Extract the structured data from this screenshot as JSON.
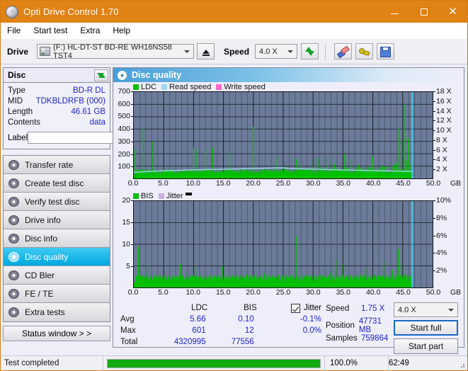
{
  "window": {
    "title": "Opti Drive Control 1.70",
    "icon": "disc-icon",
    "minimize": "–",
    "maximize": "□",
    "close": "✕"
  },
  "menu": {
    "items": [
      "File",
      "Start test",
      "Extra",
      "Help"
    ]
  },
  "toolbar": {
    "drive_label": "Drive",
    "drive_value": "(F:)  HL-DT-ST BD-RE  WH16NS58 TST4",
    "eject": "eject-icon",
    "speed_label": "Speed",
    "speed_value": "4.0 X",
    "icons": [
      "refresh-icon",
      "eraser-icon",
      "wrench-icon",
      "save-icon"
    ]
  },
  "disc": {
    "title": "Disc",
    "refresh_icon": "refresh-icon",
    "rows": [
      {
        "key": "Type",
        "value": "BD-R DL"
      },
      {
        "key": "MID",
        "value": "TDKBLDRFB (000)"
      },
      {
        "key": "Length",
        "value": "46.61 GB"
      },
      {
        "key": "Contents",
        "value": "data"
      }
    ],
    "label_key": "Label",
    "label_value": "",
    "label_placeholder": ""
  },
  "sidebar": {
    "items": [
      {
        "label": "Transfer rate",
        "selected": false
      },
      {
        "label": "Create test disc",
        "selected": false
      },
      {
        "label": "Verify test disc",
        "selected": false
      },
      {
        "label": "Drive info",
        "selected": false
      },
      {
        "label": "Disc info",
        "selected": false
      },
      {
        "label": "Disc quality",
        "selected": true
      },
      {
        "label": "CD Bler",
        "selected": false
      },
      {
        "label": "FE / TE",
        "selected": false
      },
      {
        "label": "Extra tests",
        "selected": false
      }
    ],
    "status_window": "Status window > >"
  },
  "panel": {
    "title": "Disc quality",
    "icon": "disc-quality-icon"
  },
  "stats": {
    "col_headers": [
      "",
      "LDC",
      "BIS",
      "Jitter"
    ],
    "jitter_checked": true,
    "rows": [
      {
        "label": "Avg",
        "ldc": "5.66",
        "bis": "0.10",
        "jitter": "-0.1%"
      },
      {
        "label": "Max",
        "ldc": "601",
        "bis": "12",
        "jitter": "0.0%"
      },
      {
        "label": "Total",
        "ldc": "4320995",
        "bis": "77556",
        "jitter": ""
      }
    ],
    "readout": [
      {
        "key": "Speed",
        "value": "1.75 X"
      },
      {
        "key": "Position",
        "value": "47731 MB"
      },
      {
        "key": "Samples",
        "value": "759864"
      }
    ],
    "speed_select": "4.0 X",
    "start_full": "Start full",
    "start_part": "Start part"
  },
  "statusbar": {
    "message": "Test completed",
    "percent_label": "100.0%",
    "percent_value": 100,
    "elapsed": "62:49"
  },
  "chart_data": [
    {
      "type": "area",
      "name": "ldc-chart",
      "title": "Disc quality - LDC",
      "xlabel": "GB",
      "ylabel": "LDC",
      "xlim": [
        0,
        50
      ],
      "ylim": [
        0,
        700
      ],
      "xticks": [
        "0.0",
        "5.0",
        "10.0",
        "15.0",
        "20.0",
        "25.0",
        "30.0",
        "35.0",
        "40.0",
        "45.0",
        "50.0"
      ],
      "yticks_left": [
        100,
        200,
        300,
        400,
        500,
        600,
        700
      ],
      "yticks_right": [
        "2 X",
        "4 X",
        "6 X",
        "8 X",
        "10 X",
        "12 X",
        "14 X",
        "16 X",
        "18 X"
      ],
      "y2lim": [
        0,
        19
      ],
      "unit": "GB",
      "grid": true,
      "legend": [
        {
          "label": "LDC",
          "color": "#00c000"
        },
        {
          "label": "Read speed",
          "color": "#9fd8f0"
        },
        {
          "label": "Write speed",
          "color": "#ff66cc"
        }
      ],
      "data_end_marker_gb": 46.6,
      "series": [
        {
          "name": "LDC",
          "color": "#00c000",
          "type": "spikes",
          "baseline": 28,
          "x": [
            0.2,
            0.5,
            0.9,
            1.3,
            1.6,
            2.0,
            2.4,
            2.8,
            3.2,
            3.6,
            4.0,
            4.4,
            4.8,
            5.2,
            5.6,
            6.0,
            6.4,
            6.8,
            7.2,
            7.6,
            8.0,
            8.4,
            8.8,
            9.2,
            9.6,
            10.0,
            10.4,
            10.8,
            11.2,
            11.6,
            12.0,
            12.4,
            12.8,
            13.2,
            13.6,
            14.0,
            14.4,
            14.8,
            15.2,
            15.6,
            16.0,
            16.4,
            16.8,
            17.2,
            17.6,
            18.0,
            18.4,
            18.8,
            19.2,
            19.6,
            20.0,
            20.4,
            20.8,
            21.2,
            21.6,
            22.0,
            22.4,
            22.8,
            23.2,
            23.6,
            24.0,
            24.4,
            24.8,
            25.2,
            25.6,
            26.0,
            26.4,
            26.8,
            27.2,
            27.6,
            28.0,
            28.4,
            28.8,
            29.2,
            29.6,
            30.0,
            30.4,
            30.8,
            31.2,
            31.6,
            32.0,
            32.4,
            32.8,
            33.2,
            33.6,
            34.0,
            34.4,
            34.8,
            35.2,
            35.6,
            36.0,
            36.4,
            36.8,
            37.2,
            37.6,
            38.0,
            38.4,
            38.8,
            39.2,
            39.6,
            40.0,
            40.4,
            40.8,
            41.2,
            41.6,
            42.0,
            42.4,
            42.8,
            43.2,
            43.6,
            44.0,
            44.4,
            44.8,
            45.2,
            45.6,
            46.0,
            46.4
          ],
          "y": [
            232,
            60,
            40,
            35,
            410,
            60,
            45,
            40,
            300,
            70,
            45,
            38,
            60,
            45,
            40,
            42,
            38,
            40,
            45,
            50,
            45,
            42,
            40,
            38,
            42,
            250,
            235,
            60,
            48,
            45,
            240,
            55,
            48,
            250,
            46,
            44,
            50,
            44,
            42,
            48,
            205,
            50,
            45,
            48,
            42,
            44,
            48,
            42,
            56,
            48,
            420,
            60,
            50,
            48,
            55,
            48,
            50,
            52,
            55,
            70,
            170,
            60,
            70,
            95,
            65,
            58,
            62,
            60,
            160,
            70,
            110,
            95,
            75,
            70,
            80,
            95,
            170,
            160,
            90,
            75,
            90,
            170,
            95,
            80,
            120,
            90,
            80,
            95,
            200,
            90,
            85,
            150,
            95,
            88,
            110,
            85,
            90,
            95,
            100,
            85,
            180,
            95,
            90,
            90,
            105,
            95,
            100,
            95,
            105,
            110,
            130,
            410,
            320,
            601,
            150,
            330,
            120
          ]
        },
        {
          "name": "Read speed",
          "color": "#9fd8f0",
          "type": "line",
          "x": [
            0,
            2,
            4,
            6,
            8,
            10,
            12,
            14,
            16,
            18,
            20,
            22,
            24,
            25,
            26,
            28,
            30,
            32,
            34,
            36,
            38,
            40,
            42,
            44,
            46,
            46.6
          ],
          "y_speed": [
            1.35,
            1.5,
            1.62,
            1.72,
            1.8,
            1.88,
            1.95,
            2.0,
            2.06,
            2.12,
            2.18,
            2.24,
            2.3,
            2.32,
            2.2,
            2.12,
            2.05,
            1.98,
            1.9,
            1.84,
            1.78,
            1.72,
            1.66,
            1.6,
            1.55,
            1.52
          ]
        }
      ]
    },
    {
      "type": "area",
      "name": "bis-chart",
      "title": "Disc quality - BIS",
      "xlabel": "GB",
      "ylabel": "BIS",
      "xlim": [
        0,
        50
      ],
      "ylim": [
        0,
        20
      ],
      "xticks": [
        "0.0",
        "5.0",
        "10.0",
        "15.0",
        "20.0",
        "25.0",
        "30.0",
        "35.0",
        "40.0",
        "45.0",
        "50.0"
      ],
      "yticks_left": [
        5,
        10,
        15,
        20
      ],
      "yticks_right": [
        "2%",
        "4%",
        "6%",
        "8%",
        "10%"
      ],
      "y2lim": [
        0,
        10
      ],
      "unit": "GB",
      "grid": true,
      "legend": [
        {
          "label": "BIS",
          "color": "#00c000"
        },
        {
          "label": "Jitter",
          "color": "#cbb0e0"
        }
      ],
      "data_end_marker_gb": 46.6,
      "series": [
        {
          "name": "BIS",
          "color": "#00c000",
          "type": "spikes",
          "baseline": 1.1,
          "x": [
            0.3,
            0.8,
            1.3,
            1.8,
            2.3,
            2.8,
            3.3,
            3.8,
            4.3,
            4.8,
            5.3,
            5.8,
            6.3,
            6.8,
            7.3,
            7.8,
            8.3,
            8.8,
            9.3,
            9.8,
            10.3,
            10.8,
            11.3,
            11.8,
            12.3,
            12.8,
            13.3,
            13.8,
            14.3,
            14.8,
            15.3,
            15.8,
            16.3,
            16.8,
            17.3,
            17.8,
            18.3,
            18.8,
            19.3,
            19.8,
            20.3,
            20.8,
            21.3,
            21.8,
            22.3,
            22.8,
            23.3,
            23.8,
            24.3,
            24.8,
            25.3,
            25.8,
            26.3,
            26.8,
            27.3,
            27.8,
            28.3,
            28.8,
            29.3,
            29.8,
            30.3,
            30.8,
            31.3,
            31.8,
            32.3,
            32.8,
            33.3,
            33.8,
            34.3,
            34.8,
            35.3,
            35.8,
            36.3,
            36.8,
            37.3,
            37.8,
            38.3,
            38.8,
            39.3,
            39.8,
            40.3,
            40.8,
            41.3,
            41.8,
            42.3,
            42.8,
            43.3,
            43.8,
            44.3,
            44.8,
            45.3,
            45.8,
            46.3
          ],
          "y": [
            2.4,
            9.5,
            3.0,
            2.2,
            5.2,
            2.0,
            2.4,
            2.2,
            2.6,
            2.0,
            2.2,
            2.4,
            2.0,
            2.2,
            2.6,
            5.5,
            2.4,
            2.0,
            2.2,
            2.6,
            5.0,
            2.2,
            2.4,
            2.0,
            2.6,
            2.2,
            2.0,
            2.4,
            2.2,
            5.0,
            2.6,
            2.0,
            2.2,
            2.4,
            2.0,
            2.6,
            2.2,
            3.0,
            2.4,
            2.0,
            2.8,
            2.2,
            2.4,
            3.4,
            2.2,
            2.0,
            2.6,
            2.4,
            3.0,
            2.2,
            2.4,
            2.0,
            2.6,
            2.2,
            12.0,
            2.4,
            2.0,
            2.8,
            2.2,
            2.4,
            2.6,
            2.2,
            3.0,
            2.4,
            2.0,
            3.8,
            2.6,
            6.6,
            2.4,
            5.4,
            2.2,
            2.8,
            2.4,
            2.0,
            2.6,
            3.0,
            2.4,
            4.6,
            2.2,
            2.8,
            3.0,
            2.4,
            2.6,
            6.0,
            2.2,
            2.8,
            4.0,
            2.4,
            9.0,
            5.6,
            3.0,
            2.4,
            2.6
          ]
        }
      ]
    }
  ]
}
